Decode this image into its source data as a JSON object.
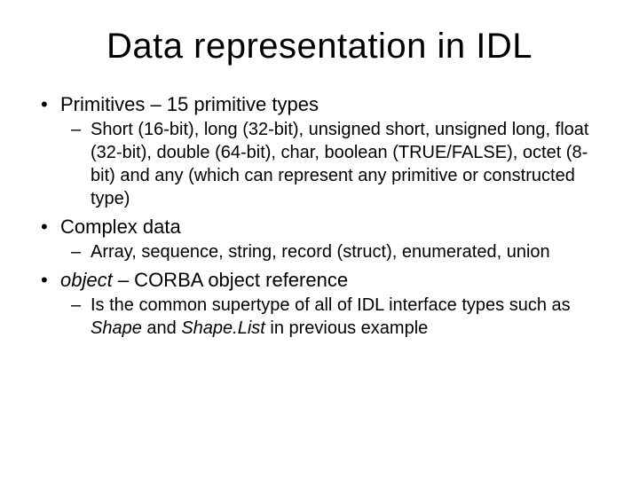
{
  "title": "Data representation in IDL",
  "b1": {
    "text": "Primitives – 15 primitive types",
    "sub": "Short (16-bit), long (32-bit), unsigned short, unsigned long, float (32-bit), double (64-bit), char, boolean (TRUE/FALSE), octet (8-bit) and any (which can represent any primitive or constructed type)"
  },
  "b2": {
    "text": "Complex data",
    "sub": "Array, sequence, string, record (struct), enumerated, union"
  },
  "b3": {
    "lead": "object",
    "rest": " – CORBA object reference",
    "sub_pre": "Is the common supertype  of all of IDL interface types such as ",
    "sub_i1": "Shape",
    "sub_mid": " and ",
    "sub_i2": "Shape.List",
    "sub_post": " in previous example"
  },
  "glyphs": {
    "bullet": "•",
    "dash": "–"
  }
}
